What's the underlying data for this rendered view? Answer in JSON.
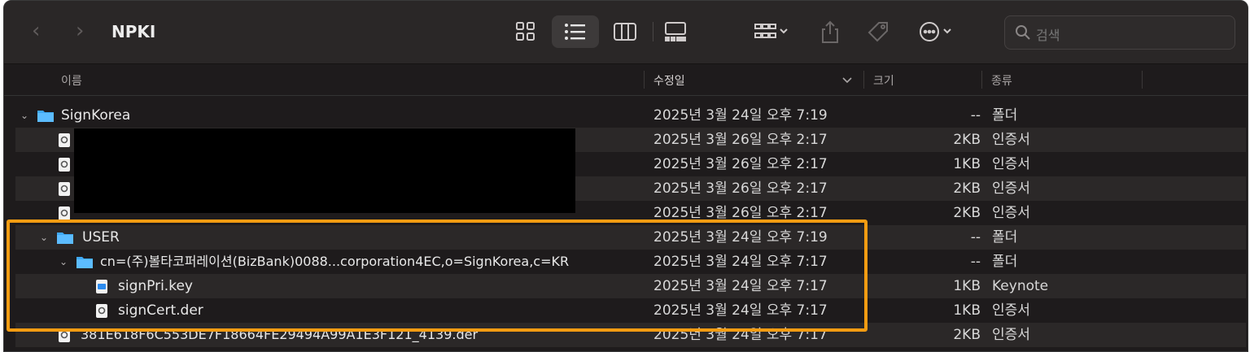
{
  "window": {
    "title": "NPKI"
  },
  "toolbar": {
    "back": "‹",
    "forward": "›",
    "search_placeholder": "검색"
  },
  "columns": {
    "name": "이름",
    "date": "수정일",
    "size": "크기",
    "kind": "종류"
  },
  "rows": [
    {
      "name": "SignKorea",
      "date": "2025년 3월 24일 오후 7:19",
      "size": "--",
      "kind": "폴더",
      "type": "folder"
    },
    {
      "name": "",
      "date": "2025년 3월 26일 오후 2:17",
      "size": "2KB",
      "kind": "인증서",
      "type": "cert"
    },
    {
      "name": "",
      "date": "2025년 3월 26일 오후 2:17",
      "size": "1KB",
      "kind": "인증서",
      "type": "cert"
    },
    {
      "name": "",
      "date": "2025년 3월 26일 오후 2:17",
      "size": "2KB",
      "kind": "인증서",
      "type": "cert"
    },
    {
      "name": "",
      "date": "2025년 3월 26일 오후 2:17",
      "size": "2KB",
      "kind": "인증서",
      "type": "cert"
    },
    {
      "name": "USER",
      "date": "2025년 3월 24일 오후 7:19",
      "size": "--",
      "kind": "폴더",
      "type": "folder"
    },
    {
      "name": "cn=(주)볼타코퍼레이션(BizBank)0088...corporation4EC,o=SignKorea,c=KR",
      "date": "2025년 3월 24일 오후 7:17",
      "size": "--",
      "kind": "폴더",
      "type": "folder"
    },
    {
      "name": "signPri.key",
      "date": "2025년 3월 24일 오후 7:17",
      "size": "1KB",
      "kind": "Keynote",
      "type": "key"
    },
    {
      "name": "signCert.der",
      "date": "2025년 3월 24일 오후 7:17",
      "size": "1KB",
      "kind": "인증서",
      "type": "cert"
    },
    {
      "name": "381E618F6C553DE7F18664FE29494A99A1E3F121_4139.der",
      "date": "2025년 3월 24일 오후 7:17",
      "size": "2KB",
      "kind": "인증서",
      "type": "cert"
    }
  ],
  "colors": {
    "highlight": "#f39c12",
    "folder": "#3fa9f5"
  }
}
